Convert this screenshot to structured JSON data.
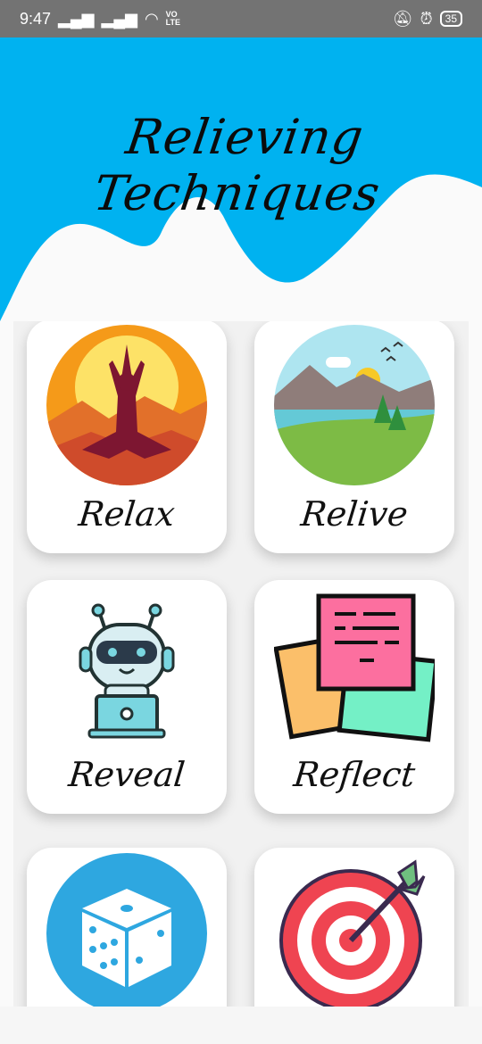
{
  "status_bar": {
    "time": "9:47",
    "volte_top": "VO",
    "volte_bottom": "LTE",
    "battery": "35"
  },
  "header": {
    "title": "Relieving Techniques",
    "wave_color": "#00b2f0"
  },
  "cards": [
    {
      "label": "Relax",
      "icon": "meditation-icon"
    },
    {
      "label": "Relive",
      "icon": "landscape-icon"
    },
    {
      "label": "Reveal",
      "icon": "robot-icon"
    },
    {
      "label": "Reflect",
      "icon": "sticky-notes-icon"
    },
    {
      "label": "",
      "icon": "dice-icon"
    },
    {
      "label": "",
      "icon": "target-icon"
    }
  ]
}
